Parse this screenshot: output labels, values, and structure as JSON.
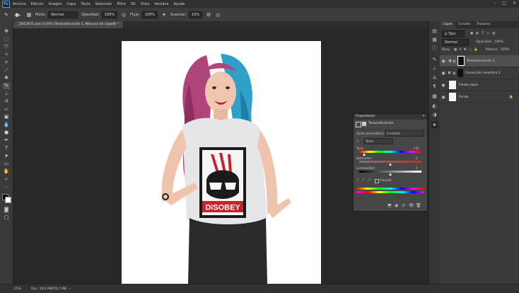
{
  "menubar": {
    "items": [
      "Archivo",
      "Edición",
      "Imagen",
      "Capa",
      "Texto",
      "Selección",
      "Filtro",
      "3D",
      "Vista",
      "Ventana",
      "Ayuda"
    ],
    "window_controls": [
      "–",
      "□",
      "✕"
    ]
  },
  "options": {
    "modo_label": "Modo:",
    "modo_value": "Normal",
    "opacidad_label": "Opacidad:",
    "opacidad_value": "100%",
    "flujo_label": "Flujo:",
    "flujo_value": "100%",
    "suavizar_label": "Suavizar:",
    "suavizar_value": "10%"
  },
  "document": {
    "tab_title": "_DSC2671.psd al 25% (Tono/saturación 1, Máscara de capa/8) *",
    "shirt_text": "DISOBEY"
  },
  "status": {
    "zoom": "25%",
    "doc_info": "Doc: 16,6 MB/50,7 MB"
  },
  "layers_panel": {
    "tabs": [
      "Capas",
      "Canales",
      "Trazados"
    ],
    "filter": "ρ Tipo",
    "blend_mode": "Normal",
    "opacity_label": "Opacidad:",
    "opacity_value": "100%",
    "lock_label": "Bloq.:",
    "fill_label": "Relleno:",
    "fill_value": "100%",
    "layers": [
      {
        "name": "Tono/saturación 1",
        "selected": true
      },
      {
        "name": "Corrección selectiva 1",
        "selected": false
      },
      {
        "name": "Fondo copia",
        "selected": false
      },
      {
        "name": "Fondo",
        "selected": false
      }
    ]
  },
  "properties": {
    "panel_title": "Propiedades",
    "adjustment": "Tono/saturación",
    "preset_label": "Ajuste preestablecido:",
    "preset_value": "A medida",
    "channel": "Todos",
    "tono_label": "Tono:",
    "tono_value": "+33",
    "saturacion_label": "Saturación:",
    "saturacion_value": "0",
    "luminosidad_label": "Luminosidad:",
    "luminosidad_value": "0",
    "colorear_label": "Colorear"
  },
  "colors": {
    "accent": "#31a8ff",
    "panel_bg": "#3a3a3a",
    "canvas_bg": "#282828"
  }
}
